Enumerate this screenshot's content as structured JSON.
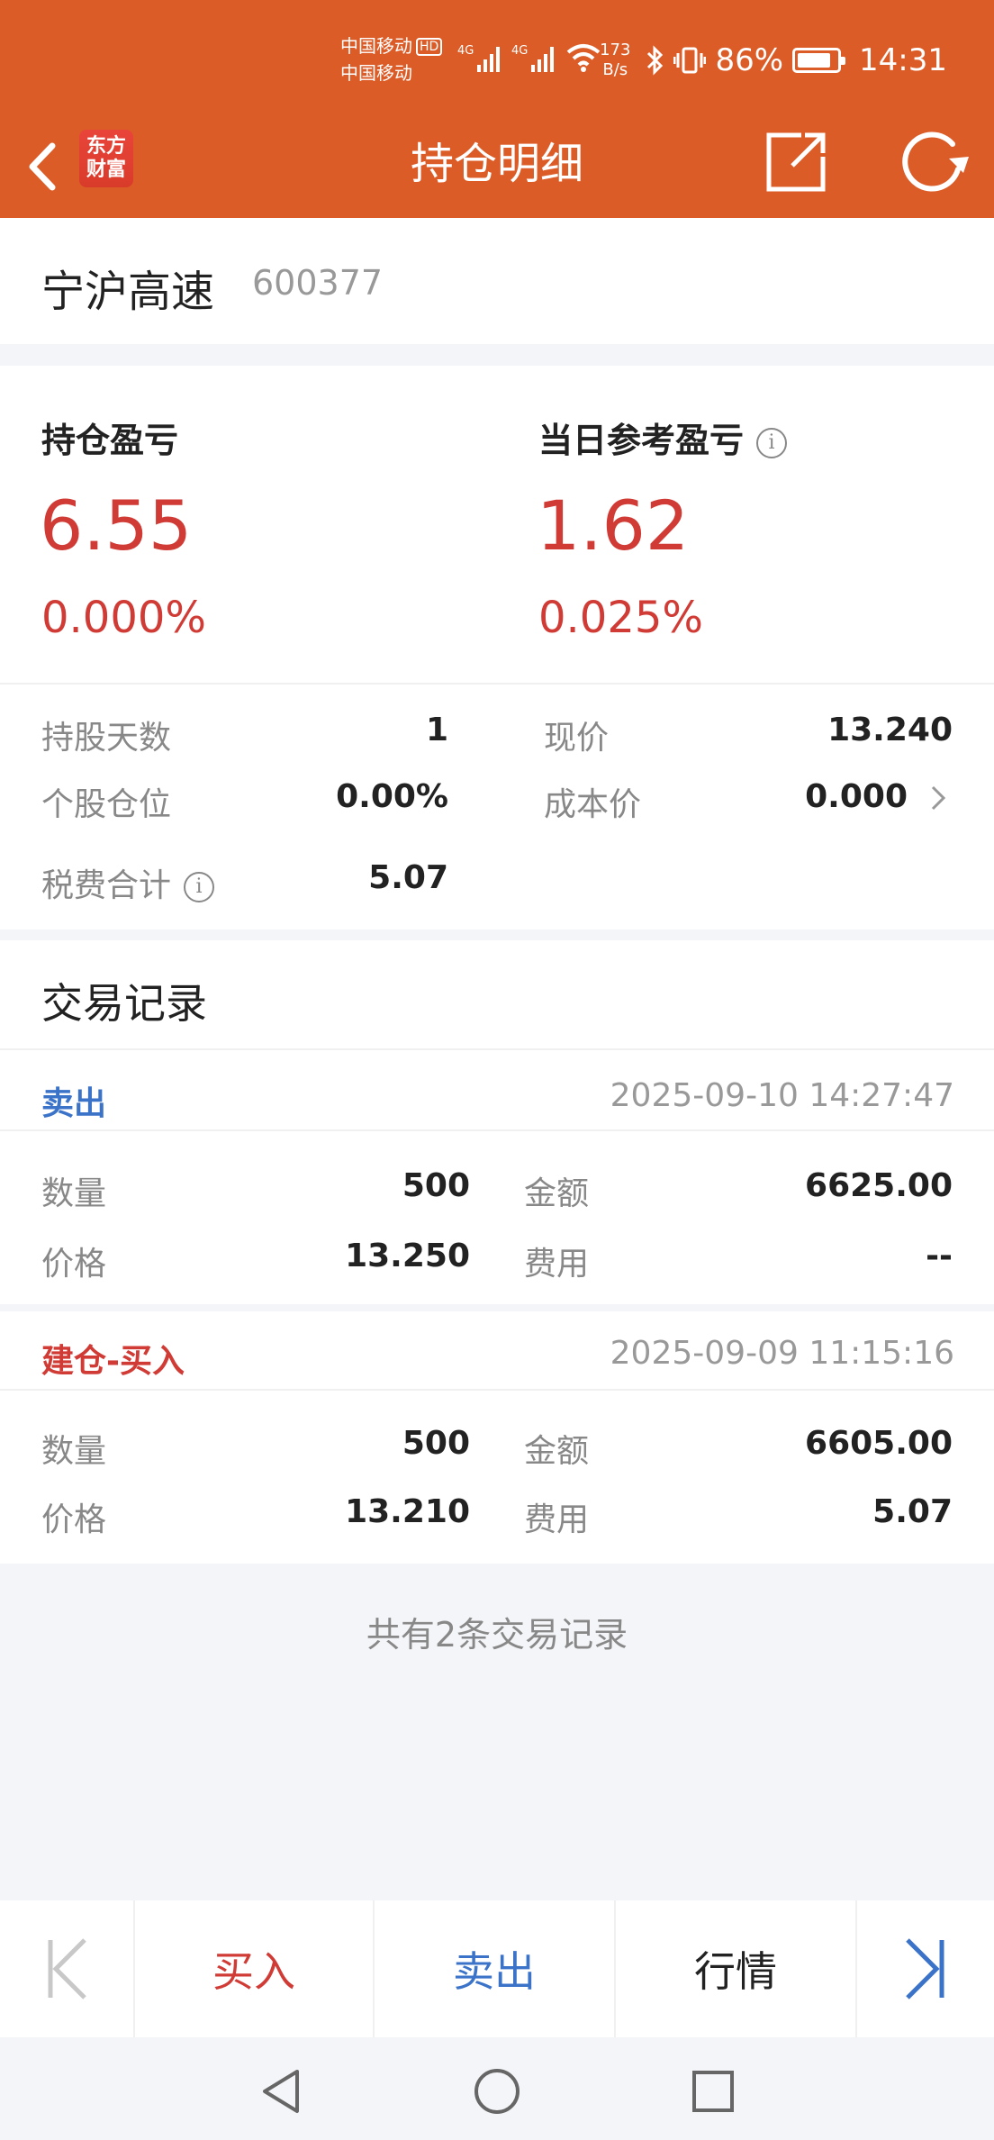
{
  "status_bar": {
    "carrier_1": "中国移动",
    "hd_badge": "HD",
    "carrier_2": "中国移动",
    "net_1": "4G",
    "net_2": "4G",
    "speed_value": "173",
    "speed_unit": "B/s",
    "battery_percent": "86%",
    "battery_level": 0.86,
    "time": "14:31"
  },
  "header": {
    "logo_line1": "东方",
    "logo_line2": "财富",
    "title": "持仓明细"
  },
  "stock": {
    "name": "宁沪高速",
    "code": "600377"
  },
  "pnl": {
    "position_label": "持仓盈亏",
    "position_value": "6.55",
    "position_pct": "0.000%",
    "daily_label": "当日参考盈亏",
    "daily_value": "1.62",
    "daily_pct": "0.025%",
    "info_glyph": "i"
  },
  "details": {
    "hold_days_label": "持股天数",
    "hold_days_value": "1",
    "current_price_label": "现价",
    "current_price_value": "13.240",
    "position_ratio_label": "个股仓位",
    "position_ratio_value": "0.00%",
    "cost_price_label": "成本价",
    "cost_price_value": "0.000",
    "fees_label": "税费合计",
    "fees_value": "5.07"
  },
  "trades": {
    "section_title": "交易记录",
    "records": [
      {
        "type": "卖出",
        "type_color": "#3b73c9",
        "time": "2025-09-10 14:27:47",
        "qty_label": "数量",
        "qty": "500",
        "amount_label": "金额",
        "amount": "6625.00",
        "price_label": "价格",
        "price": "13.250",
        "fee_label": "费用",
        "fee": "--"
      },
      {
        "type": "建仓-买入",
        "type_color": "#d03b35",
        "time": "2025-09-09 11:15:16",
        "qty_label": "数量",
        "qty": "500",
        "amount_label": "金额",
        "amount": "6605.00",
        "price_label": "价格",
        "price": "13.210",
        "fee_label": "费用",
        "fee": "5.07"
      }
    ],
    "summary": "共有2条交易记录"
  },
  "toolbar": {
    "buy": "买入",
    "sell": "卖出",
    "quote": "行情"
  },
  "colors": {
    "brand": "#dc5c27",
    "up_red": "#d03b35",
    "link_blue": "#3b73c9"
  },
  "icons": {
    "back": "chevron-left-icon",
    "share": "share-icon",
    "refresh": "refresh-icon",
    "first": "skip-first-icon",
    "last": "skip-last-icon",
    "nav_back": "triangle-back-icon",
    "nav_home": "circle-home-icon",
    "nav_recent": "square-recent-icon"
  }
}
